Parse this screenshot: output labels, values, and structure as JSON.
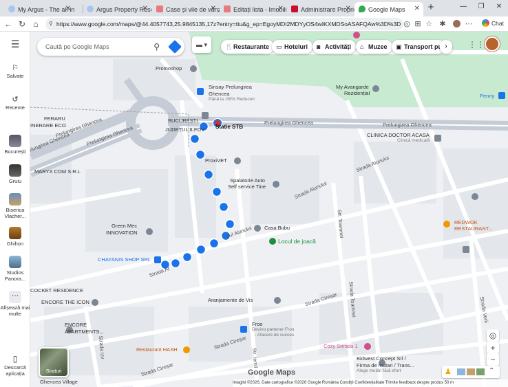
{
  "browser": {
    "tabs": [
      {
        "title": "My Argus - The all-in",
        "color": "#a9c6f0"
      },
      {
        "title": "Argus Property Reso",
        "color": "#a9c6f0"
      },
      {
        "title": "Case și vile de vânzar",
        "color": "#e77a7a"
      },
      {
        "title": "Editați lista - Imobili",
        "color": "#e77a7a"
      },
      {
        "title": "Administrare Propriet",
        "color": "#c8102e"
      },
      {
        "title": "Google Maps",
        "color": "#34a853"
      }
    ],
    "url": "https://www.google.com/maps/@44.4057743,25.9845135,17z?entry=ttu&g_ep=EgoyMDI2MDYyOS4wIKXMDSoASAFQAw%3D%3D",
    "chat_label": "Chat"
  },
  "sidebar": {
    "menu_icon": "hamburger-icon",
    "items": [
      {
        "label": "Salvate",
        "icon": "bookmark-icon"
      },
      {
        "label": "Recente",
        "icon": "history-icon"
      },
      {
        "label": "București",
        "icon": "place-thumbnail"
      },
      {
        "label": "Gruiu",
        "icon": "place-thumbnail"
      },
      {
        "label": "Biserica Vlacher...",
        "icon": "place-thumbnail"
      },
      {
        "label": "Ghihon",
        "icon": "place-thumbnail"
      },
      {
        "label": "Studios Panora...",
        "icon": "place-thumbnail"
      },
      {
        "label": "Afișează mai multe",
        "icon": "more-icon"
      },
      {
        "label": "Descarcă aplicația",
        "icon": "phone-icon"
      }
    ]
  },
  "search": {
    "placeholder": "Caută pe Google Maps"
  },
  "chips": [
    {
      "label": "Restaurante",
      "icon": "fork-knife-icon"
    },
    {
      "label": "Hoteluri",
      "icon": "bed-icon"
    },
    {
      "label": "Activități",
      "icon": "camera-icon"
    },
    {
      "label": "Muzee",
      "icon": "museum-icon"
    },
    {
      "label": "Transport pub",
      "icon": "bus-icon"
    }
  ],
  "map_labels": {
    "promoshop": "Promoshop",
    "sinsay": "Sinsay Prelungirea",
    "sinsay2": "Ghencea",
    "sinsay_sub": "Până la -50% Reduceri",
    "my_avangarde": "My Avangarde",
    "my_avangarde2": "Rezidențial",
    "penny": "Penny",
    "feraru": "FERARU",
    "funerare": "INERARE ECO",
    "bucuresti": "BUCUREȘTI",
    "judetul_ilfov": "JUDEȚUL ILFOV",
    "statie_stb": "Statie STB",
    "prel_ghencea_1": "Prelungirea Ghencea",
    "prel_ghencea_2": "Prelungirea Ghencea",
    "prel_ghencea_3": "Prelungirea Ghencea",
    "prel_ghencea_4": "Prelungirea Ghencea",
    "prel_ghencea_5": "Prelungirea Ghencea",
    "clinica": "CLINICA DOCTOR ACASA",
    "clinica_sub": "Clinică medicală",
    "maryx": "MARYX COM S.R.L",
    "proxivet": "ProxiVET",
    "spalatorie": "Spalatorie Auto",
    "spalatorie2": "Self service Tine",
    "strada_alunului_1": "Strada Alunului",
    "strada_alunului_2": "Strada Alunului",
    "strada_alunului_3": "dul Alunului",
    "str_toamnei_1": "Str. Toamnei",
    "str_toamnei_2": "Strada Toamnei",
    "redwok": "REDWOK",
    "redwok2": "RESTAURANT...",
    "green_mec": "Green Mec",
    "green_mec2": "INNOVATION",
    "casa_bubu": "Casa Bubu",
    "locul_joaca": "Locul de joacă",
    "chayanis": "CHAYANIS SHOP SRL",
    "strada_ar": "Strada Ar",
    "cocket": "COCKET RESIDENCE",
    "encore_icon": "ENCORE THE ICON",
    "aranjamente": "Aranjamente de Vis",
    "strada_ciresar_1": "Strada Cireșar",
    "strada_ciresar_2": "Strada Cireșar",
    "strada_ciresar_3": "Strada Cireșar",
    "strada_veriii": "Strada Verii",
    "encore_apts": "ENCORE",
    "encore_apts2": "APARTMENTS...",
    "froo": "Froo",
    "froo_sub": "Devino partener Froo",
    "froo_sub2": "- Afacere de succes",
    "restaurant_hash": "Restaurant HASH",
    "cozy_sorada": "Cozy Sorada 1",
    "bidwest": "Bidwest Concept Srl /",
    "bidwest2": "Firma de mutari / Trans...",
    "bidwest_sub": "Alege mutări fără efort",
    "strada_izvor": "Strada Izv",
    "str_lemil": "Str. Iemil",
    "ghencea_village": "Ghencea Village"
  },
  "controls": {
    "layers_label": "Straturi",
    "zoom_in": "+",
    "zoom_out": "−",
    "locate_icon": "my-location-icon"
  },
  "attribution": {
    "logo": "Google Maps",
    "text": "Imagini ©2026, Date cartografice ©2026 Google   România   Condiții   Confidențialitate   Trimite feedback despre produs   50 m"
  },
  "colors": {
    "route_dot": "#1a73e8",
    "road": "#ffffff",
    "main_road": "#c5ccd6",
    "park": "#c7ead0",
    "building": "#e3e6ea"
  }
}
